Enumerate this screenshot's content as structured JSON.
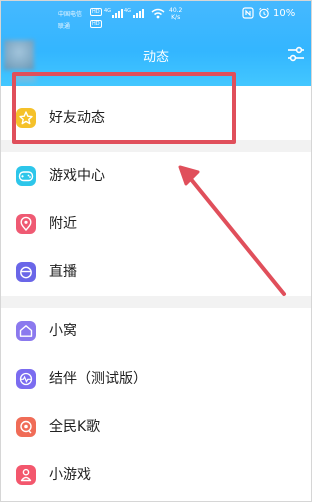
{
  "status_bar": {
    "carrier_top": "中国电信",
    "carrier_bottom": "联通",
    "hd_top": "HD",
    "hd_bottom": "HD",
    "net_tag_1": "4G",
    "net_tag_2": "4G",
    "speed_value": "40.2",
    "speed_unit": "K/s",
    "battery_percent": "10%"
  },
  "header": {
    "title": "动态"
  },
  "menu": {
    "items": [
      {
        "label": "好友动态",
        "icon": "star-icon",
        "color": "#f5c12a"
      },
      {
        "label": "游戏中心",
        "icon": "gamepad-icon",
        "color": "#2dc6ea"
      },
      {
        "label": "附近",
        "icon": "location-icon",
        "color": "#ef5a73"
      },
      {
        "label": "直播",
        "icon": "live-icon",
        "color": "#6a66e8"
      },
      {
        "label": "小窝",
        "icon": "home-icon",
        "color": "#8b79ee"
      },
      {
        "label": "结伴（测试版）",
        "icon": "partner-icon",
        "color": "#7b6cf0"
      },
      {
        "label": "全民K歌",
        "icon": "karaoke-icon",
        "color": "#f06c57"
      },
      {
        "label": "小游戏",
        "icon": "minigame-icon",
        "color": "#f3576d"
      }
    ]
  },
  "annotation": {
    "highlight_color": "#e04f5b"
  }
}
